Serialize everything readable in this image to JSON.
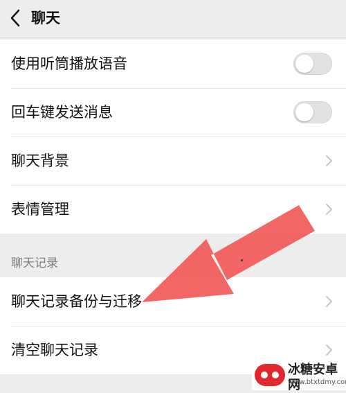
{
  "header": {
    "title": "聊天",
    "back_icon": "chevron-left-icon"
  },
  "group1": {
    "items": [
      {
        "label": "使用听筒播放语音",
        "control": "toggle",
        "on": false
      },
      {
        "label": "回车键发送消息",
        "control": "toggle",
        "on": false
      },
      {
        "label": "聊天背景",
        "control": "chevron"
      },
      {
        "label": "表情管理",
        "control": "chevron"
      }
    ]
  },
  "section": {
    "title": "聊天记录"
  },
  "group2": {
    "items": [
      {
        "label": "聊天记录备份与迁移",
        "control": "chevron"
      },
      {
        "label": "清空聊天记录",
        "control": "chevron"
      }
    ]
  },
  "annotation": {
    "arrow_color": "#f25a5a",
    "points_to": "聊天记录备份与迁移"
  },
  "watermark": {
    "text": "冰糖安卓网",
    "url": "www.btxtdmy.com",
    "color": "#e0282d"
  }
}
